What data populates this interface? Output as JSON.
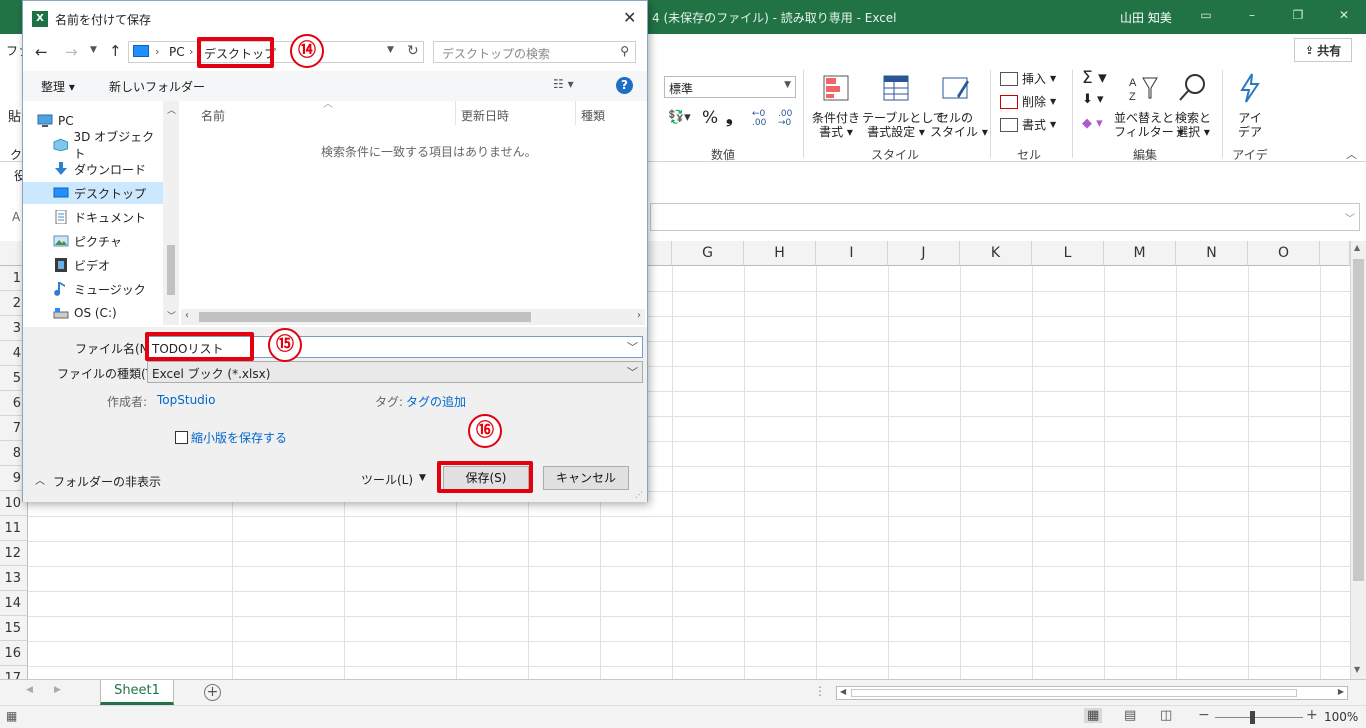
{
  "excel": {
    "title": "4 (未保存のファイル) - 読み取り専用 - Excel",
    "user": "山田 知美",
    "share_label": "共有",
    "number_format": "標準",
    "groups": [
      "数値",
      "スタイル",
      "セル",
      "編集",
      "アイデア"
    ],
    "ribbon_buttons": {
      "cond_format": "条件付き\n書式 ▾",
      "table_format": "テーブルとして\n書式設定 ▾",
      "cell_style": "セルの\nスタイル ▾",
      "insert": "挿入",
      "delete": "削除",
      "format": "書式",
      "sort_filter": "並べ替えと\nフィルター ▾",
      "find_select": "検索と\n選択 ▾",
      "ideas": "アイ\nデア"
    },
    "columns": [
      "G",
      "H",
      "I",
      "J",
      "K",
      "L",
      "M",
      "N",
      "O"
    ],
    "rows": [
      "1",
      "2",
      "3",
      "4",
      "5",
      "6",
      "7",
      "8",
      "9",
      "10",
      "11",
      "12",
      "13",
      "14",
      "15",
      "16",
      "17"
    ],
    "sheet_tab": "Sheet1",
    "zoom": "100%",
    "left_cut_labels": [
      "ファ",
      "貼",
      "ク",
      "役",
      "A"
    ]
  },
  "dialog": {
    "title": "名前を付けて保存",
    "breadcrumb": [
      "PC",
      "デスクトップ"
    ],
    "search_placeholder": "デスクトップの検索",
    "organize": "整理 ▾",
    "new_folder": "新しいフォルダー",
    "nav_items": [
      {
        "label": "PC",
        "icon": "pc-icon"
      },
      {
        "label": "3D オブジェクト",
        "icon": "cube-icon"
      },
      {
        "label": "ダウンロード",
        "icon": "download-icon"
      },
      {
        "label": "デスクトップ",
        "icon": "desktop-icon"
      },
      {
        "label": "ドキュメント",
        "icon": "document-icon"
      },
      {
        "label": "ピクチャ",
        "icon": "picture-icon"
      },
      {
        "label": "ビデオ",
        "icon": "video-icon"
      },
      {
        "label": "ミュージック",
        "icon": "music-icon"
      },
      {
        "label": "OS (C:)",
        "icon": "drive-icon"
      }
    ],
    "headers": [
      "名前",
      "更新日時",
      "種類"
    ],
    "empty_message": "検索条件に一致する項目はありません。",
    "filename_label": "ファイル名(N):",
    "filename_value": "TODOリスト",
    "filetype_label": "ファイルの種類(T):",
    "filetype_value": "Excel ブック (*.xlsx)",
    "author_label": "作成者:",
    "author_value": "TopStudio",
    "tag_label": "タグ:",
    "tag_value": "タグの追加",
    "thumbnail_label": "縮小版を保存する",
    "hide_folders": "フォルダーの非表示",
    "tools": "ツール(L)",
    "save": "保存(S)",
    "cancel": "キャンセル",
    "step_badges": [
      "⑭",
      "⑮",
      "⑯"
    ]
  },
  "colors": {
    "excel_green": "#217346",
    "highlight_red": "#e3000f",
    "link_blue": "#0066cc"
  }
}
